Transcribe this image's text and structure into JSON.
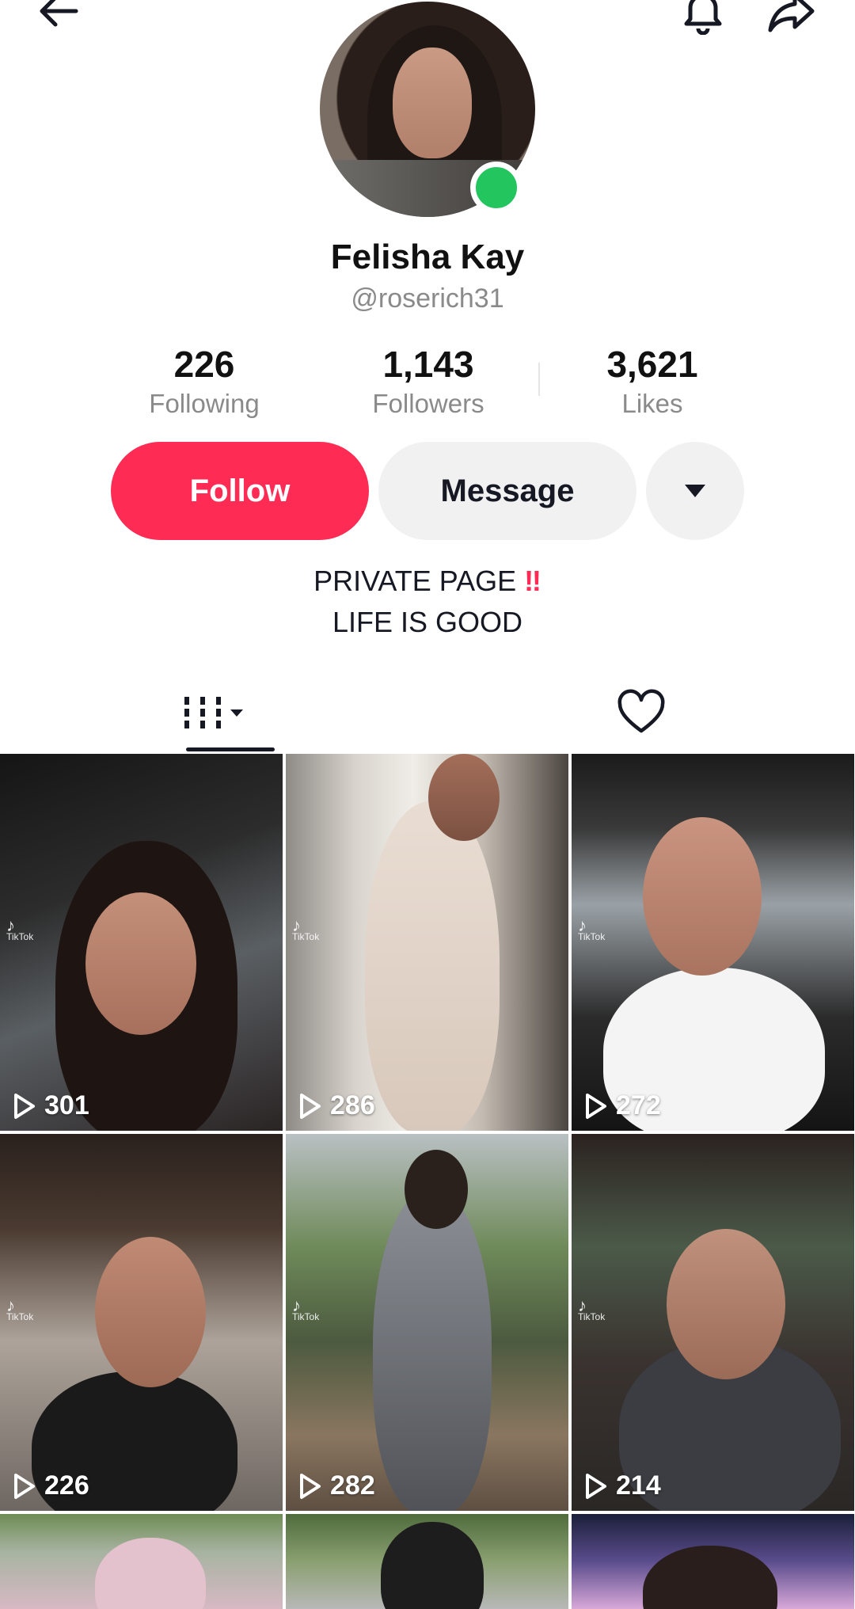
{
  "profile": {
    "display_name": "Felisha Kay",
    "username": "@roserich31",
    "online": true
  },
  "stats": [
    {
      "value": "226",
      "label": "Following"
    },
    {
      "value": "1,143",
      "label": "Followers"
    },
    {
      "value": "3,621",
      "label": "Likes"
    }
  ],
  "actions": {
    "follow_label": "Follow",
    "message_label": "Message"
  },
  "bio": {
    "line1": "PRIVATE PAGE",
    "line1_emoji": "‼",
    "line2": "LIFE IS GOOD"
  },
  "tabs": {
    "videos_icon": "grid-bars-icon",
    "liked_icon": "heart-outline-icon"
  },
  "watermark": {
    "brand": "TikTok"
  },
  "videos": [
    {
      "plays": "301"
    },
    {
      "plays": "286"
    },
    {
      "plays": "272"
    },
    {
      "plays": "226"
    },
    {
      "plays": "282"
    },
    {
      "plays": "214"
    }
  ],
  "colors": {
    "accent": "#fe2c55",
    "online": "#22c55e",
    "muted_text": "#8a8a8a",
    "button_gray": "#f1f1f2"
  }
}
